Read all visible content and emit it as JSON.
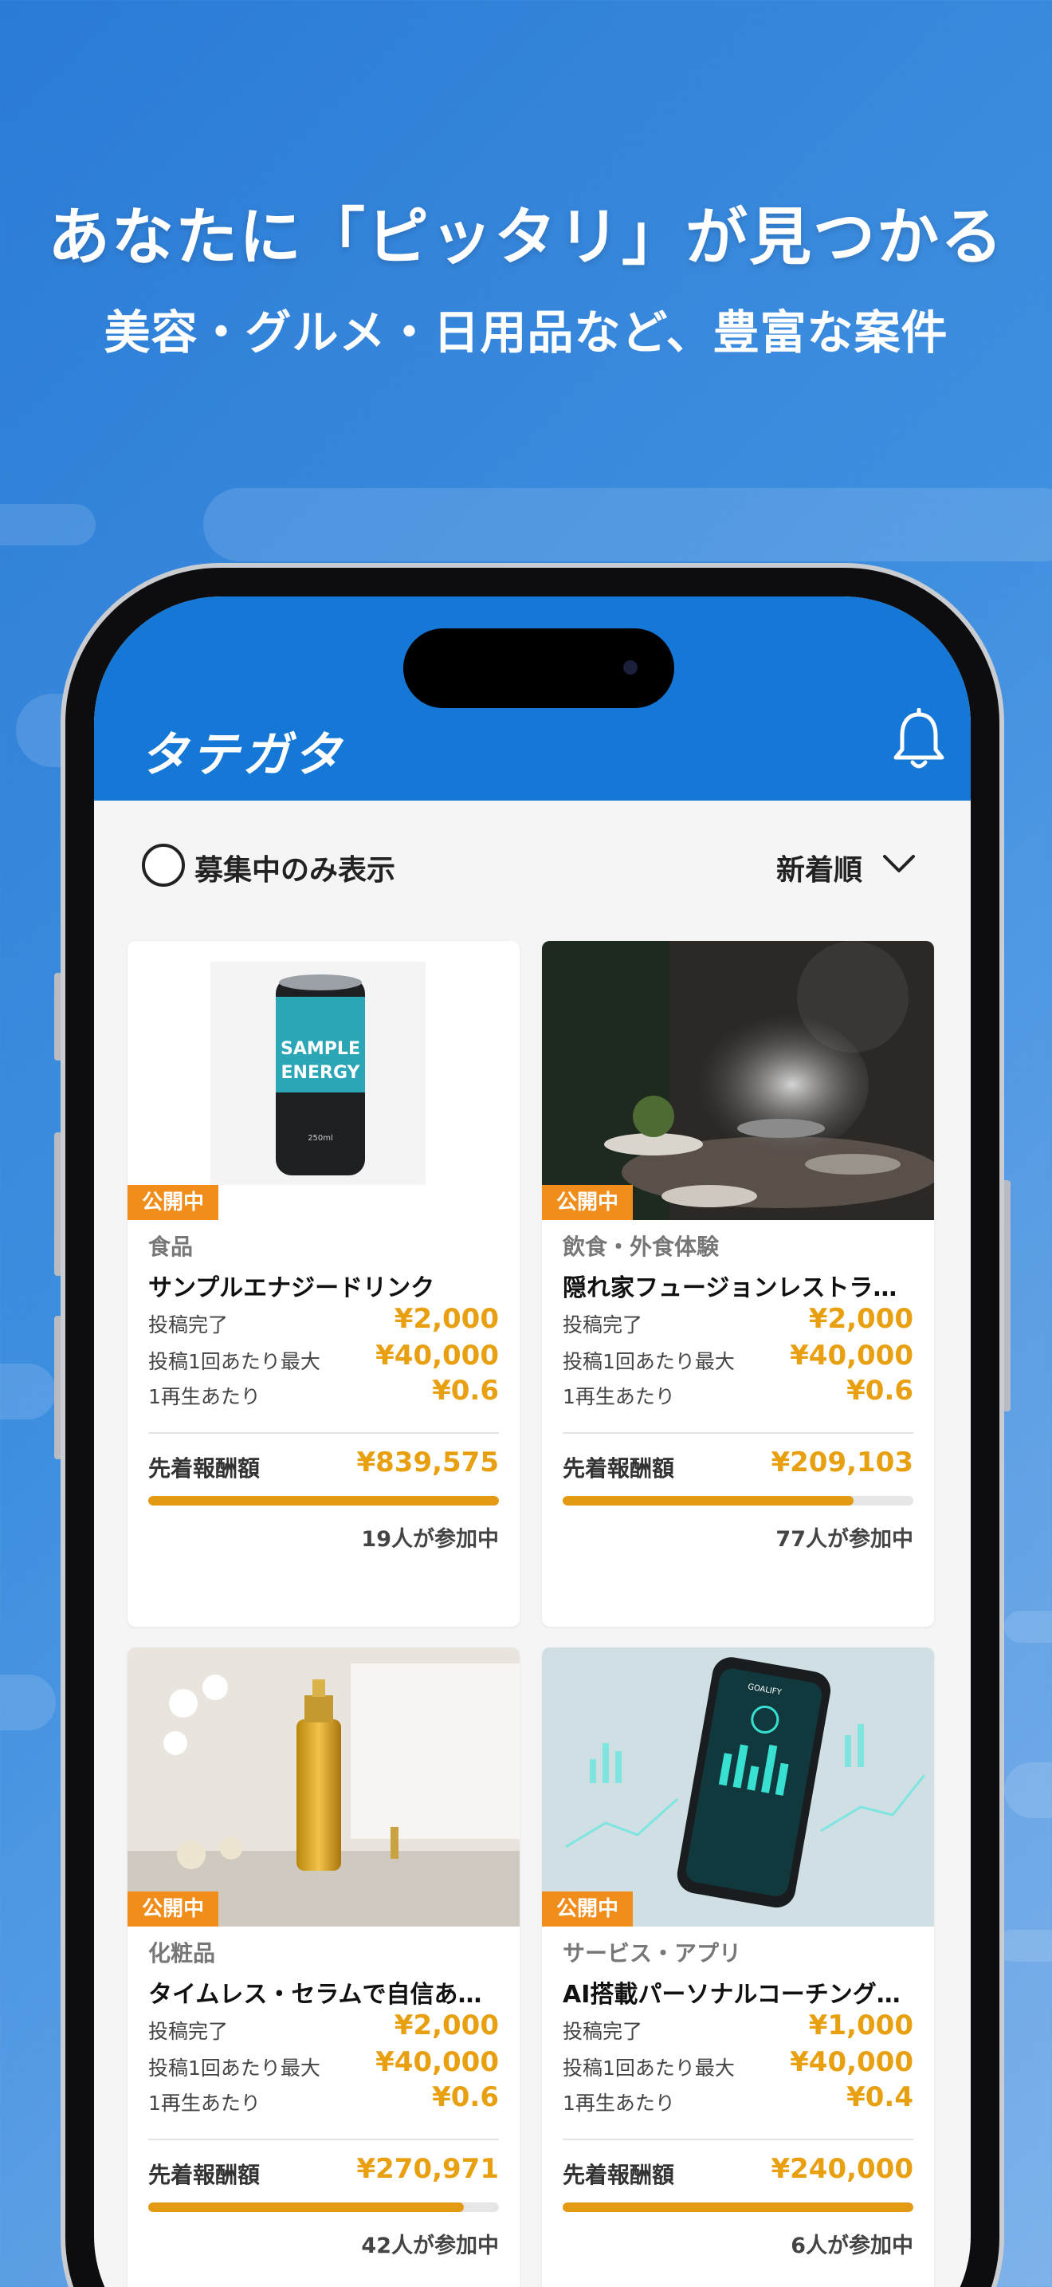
{
  "promo": {
    "headline": "あなたに「ピッタリ」が見つかる",
    "subline": "美容・グルメ・日用品など、豊富な案件"
  },
  "app": {
    "logo": "タテガタ",
    "notification_icon": "bell-icon",
    "brand_color": "#1577d6"
  },
  "filter": {
    "recruiting_only_label": "募集中のみ表示",
    "sort_label": "新着順"
  },
  "cards": [
    {
      "badge": "公開中",
      "category": "食品",
      "title": "サンプルエナジードリンク",
      "can_text_1": "SAMPLE",
      "can_text_2": "ENERGY",
      "can_text_3": "250ml",
      "rows": [
        {
          "label": "投稿完了",
          "value": "¥2,000"
        },
        {
          "label": "投稿1回あたり最大",
          "value": "¥40,000"
        },
        {
          "label": "1再生あたり",
          "value": "¥0.6"
        }
      ],
      "total_label": "先着報酬額",
      "total_value": "¥839,575",
      "progress": 1.0,
      "participants": "19人が参加中"
    },
    {
      "badge": "公開中",
      "category": "飲食・外食体験",
      "title": "隠れ家フュージョンレストランで…",
      "rows": [
        {
          "label": "投稿完了",
          "value": "¥2,000"
        },
        {
          "label": "投稿1回あたり最大",
          "value": "¥40,000"
        },
        {
          "label": "1再生あたり",
          "value": "¥0.6"
        }
      ],
      "total_label": "先着報酬額",
      "total_value": "¥209,103",
      "progress": 0.83,
      "participants": "77人が参加中"
    },
    {
      "badge": "公開中",
      "category": "化粧品",
      "title": "タイムレス・セラムで自信あふれ…",
      "rows": [
        {
          "label": "投稿完了",
          "value": "¥2,000"
        },
        {
          "label": "投稿1回あたり最大",
          "value": "¥40,000"
        },
        {
          "label": "1再生あたり",
          "value": "¥0.6"
        }
      ],
      "total_label": "先着報酬額",
      "total_value": "¥270,971",
      "progress": 0.9,
      "participants": "42人が参加中"
    },
    {
      "badge": "公開中",
      "category": "サービス・アプリ",
      "title": "AI搭載パーソナルコーチングアプリ",
      "app_name": "GOALIFY",
      "rows": [
        {
          "label": "投稿完了",
          "value": "¥1,000"
        },
        {
          "label": "投稿1回あたり最大",
          "value": "¥40,000"
        },
        {
          "label": "1再生あたり",
          "value": "¥0.4"
        }
      ],
      "total_label": "先着報酬額",
      "total_value": "¥240,000",
      "progress": 1.0,
      "participants": "6人が参加中"
    }
  ]
}
